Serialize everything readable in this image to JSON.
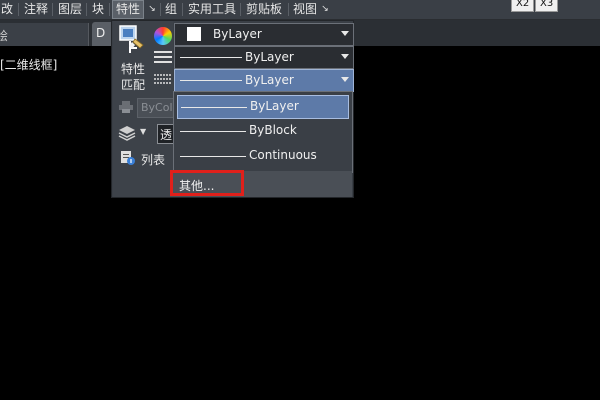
{
  "menubar": {
    "items": [
      {
        "label": "改"
      },
      {
        "label": "注释"
      },
      {
        "label": "图层"
      },
      {
        "label": "块"
      },
      {
        "label": "特性"
      },
      {
        "label": "组"
      },
      {
        "label": "实用工具"
      },
      {
        "label": "剪贴板"
      },
      {
        "label": "视图"
      }
    ],
    "window_buttons": [
      "X2",
      "X3"
    ]
  },
  "tabs": {
    "left_tab_fragment": "绘",
    "active_tab_fragment": "D"
  },
  "viewport": {
    "label": "[二维线框]"
  },
  "properties_panel": {
    "match_label": "特性匹配",
    "color_box_placeholder": "ByColor",
    "transparency_fragment": "透",
    "list_label": "列表",
    "color_dropdown": {
      "value": "ByLayer",
      "swatch_color": "#ffffff"
    },
    "lineweight_dropdown": {
      "value": "ByLayer"
    },
    "linetype_dropdown": {
      "value": "ByLayer"
    }
  },
  "linetype_list": {
    "options": [
      {
        "label": "ByLayer",
        "selected": true
      },
      {
        "label": "ByBlock",
        "selected": false
      },
      {
        "label": "Continuous",
        "selected": false
      }
    ],
    "other_label": "其他..."
  },
  "colors": {
    "highlight": "#e0201b",
    "selected_bg": "#5d7aa8"
  }
}
